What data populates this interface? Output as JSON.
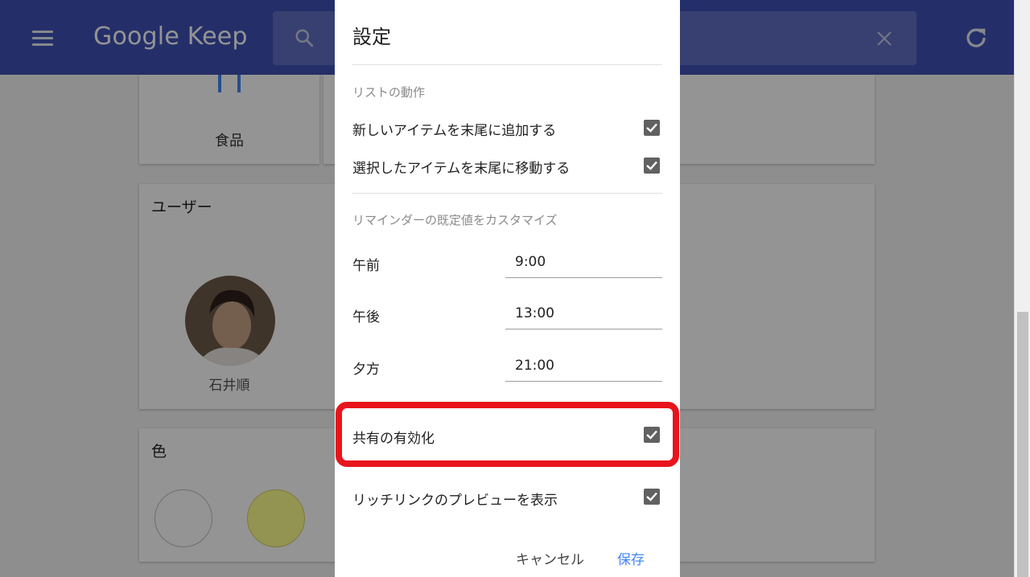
{
  "header": {
    "logo": "Google Keep",
    "search": {
      "placeholder": ""
    }
  },
  "cards": {
    "food": {
      "label": "食品"
    },
    "user": {
      "title": "ユーザー",
      "name": "石井順"
    },
    "color": {
      "title": "色",
      "swatches": [
        "#ffffff",
        "#ffff8d"
      ]
    }
  },
  "settings": {
    "title": "設定",
    "list_section": "リストの動作",
    "add_bottom": {
      "label": "新しいアイテムを末尾に追加する",
      "checked": true
    },
    "move_checked": {
      "label": "選択したアイテムを末尾に移動する",
      "checked": true
    },
    "reminder_section": "リマインダーの既定値をカスタマイズ",
    "morning": {
      "label": "午前",
      "value": "9:00"
    },
    "afternoon": {
      "label": "午後",
      "value": "13:00"
    },
    "evening": {
      "label": "夕方",
      "value": "21:00"
    },
    "sharing": {
      "label": "共有の有効化",
      "checked": true
    },
    "rich_link": {
      "label": "リッチリンクのプレビューを表示",
      "checked": true
    },
    "cancel": "キャンセル",
    "save": "保存"
  },
  "colors": {
    "header": "#3f51b5",
    "highlight": "#e8141b",
    "accent": "#4285f4"
  }
}
